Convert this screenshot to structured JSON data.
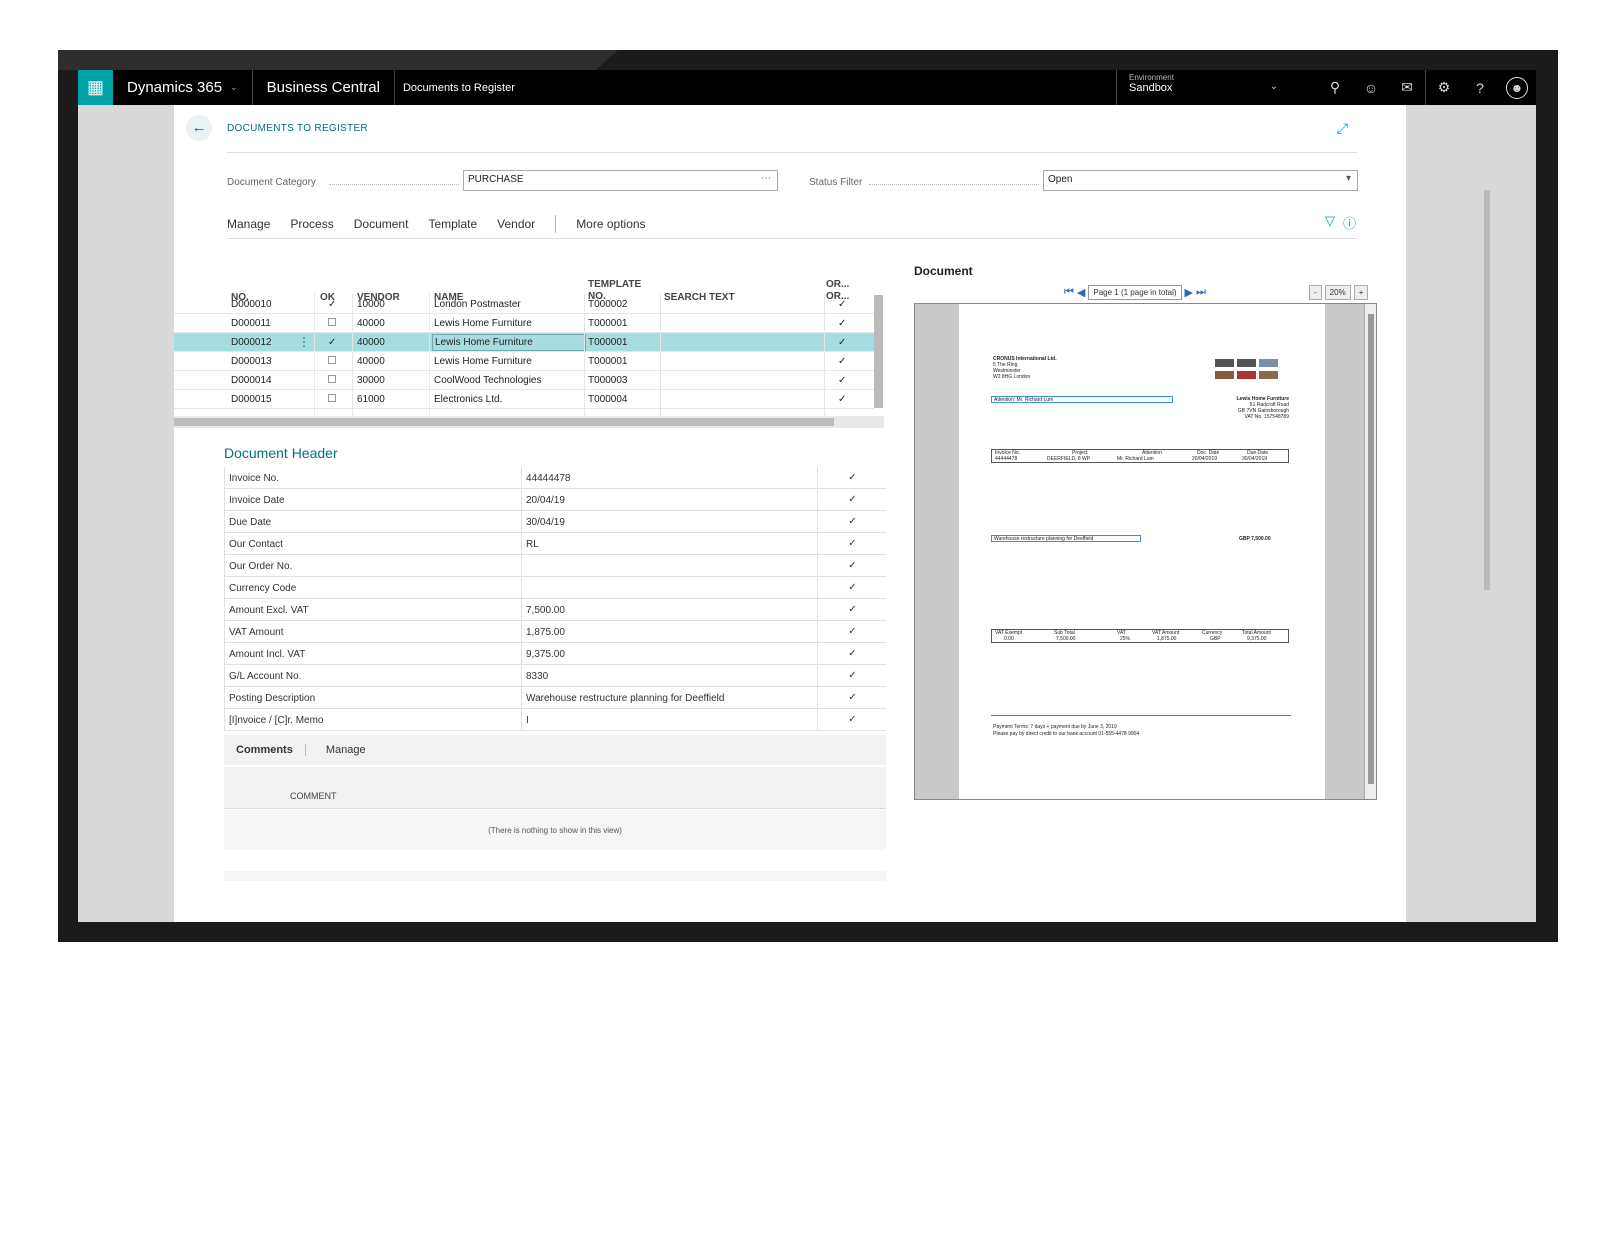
{
  "topbar": {
    "product": "Dynamics 365",
    "app": "Business Central",
    "breadcrumb": "Documents to Register",
    "environment_label": "Environment",
    "environment_value": "Sandbox"
  },
  "page": {
    "title": "DOCUMENTS TO REGISTER",
    "document_category_label": "Document Category",
    "document_category_value": "PURCHASE",
    "status_filter_label": "Status Filter",
    "status_filter_value": "Open"
  },
  "actions": [
    "Manage",
    "Process",
    "Document",
    "Template",
    "Vendor",
    "More options"
  ],
  "grid": {
    "headers": {
      "no": "NO.",
      "ok": "OK",
      "vendor": "VENDOR",
      "name": "NAME",
      "template1": "TEMPLATE",
      "template2": "NO.",
      "search": "SEARCH TEXT",
      "or1": "OR...",
      "or2": "OR..."
    },
    "rows": [
      {
        "no": "D000010",
        "ok": "✓",
        "vendor": "10000",
        "name": "London Postmaster",
        "template": "T000002",
        "or": "✓"
      },
      {
        "no": "D000011",
        "ok": "",
        "vendor": "40000",
        "name": "Lewis Home Furniture",
        "template": "T000001",
        "or": "✓"
      },
      {
        "no": "D000012",
        "ok": "✓",
        "vendor": "40000",
        "name": "Lewis Home Furniture",
        "template": "T000001",
        "or": "✓"
      },
      {
        "no": "D000013",
        "ok": "",
        "vendor": "40000",
        "name": "Lewis Home Furniture",
        "template": "T000001",
        "or": "✓"
      },
      {
        "no": "D000014",
        "ok": "",
        "vendor": "30000",
        "name": "CoolWood Technologies",
        "template": "T000003",
        "or": "✓"
      },
      {
        "no": "D000015",
        "ok": "",
        "vendor": "61000",
        "name": "Electronics Ltd.",
        "template": "T000004",
        "or": "✓"
      }
    ]
  },
  "document_header": {
    "title": "Document Header",
    "rows": [
      {
        "label": "Invoice No.",
        "value": "44444478",
        "check": "✓"
      },
      {
        "label": "Invoice Date",
        "value": "20/04/19",
        "check": "✓"
      },
      {
        "label": "Due Date",
        "value": "30/04/19",
        "check": "✓"
      },
      {
        "label": "Our Contact",
        "value": "RL",
        "check": "✓"
      },
      {
        "label": "Our Order No.",
        "value": "",
        "check": "✓"
      },
      {
        "label": "Currency Code",
        "value": "",
        "check": "✓"
      },
      {
        "label": "Amount Excl. VAT",
        "value": "7,500.00",
        "check": "✓"
      },
      {
        "label": "VAT Amount",
        "value": "1,875.00",
        "check": "✓"
      },
      {
        "label": "Amount Incl. VAT",
        "value": "9,375.00",
        "check": "✓"
      },
      {
        "label": "G/L Account No.",
        "value": "8330",
        "check": "✓"
      },
      {
        "label": "Posting Description",
        "value": "Warehouse restructure planning for Deeffield",
        "check": "✓"
      },
      {
        "label": "[I]nvoice / [C]r. Memo",
        "value": "I",
        "check": "✓"
      }
    ]
  },
  "comments": {
    "tab_comments": "Comments",
    "tab_manage": "Manage",
    "column": "COMMENT",
    "empty": "(There is nothing to show in this view)"
  },
  "document_preview": {
    "title": "Document",
    "page_indicator": "Page 1 (1 page in total)",
    "zoom": "20%",
    "zoom_minus": "-",
    "zoom_plus": "+",
    "sender": [
      "CRONUS International Ltd.",
      "5 The Ring",
      "Westminster",
      "W2 8HG London"
    ],
    "attention": "Attention: Mr. Richard Lum",
    "recipient": [
      "Lewis Home Furniture",
      "51 Radcroft Road",
      "GB 7VN Gainsborough",
      "VAT No. 157548789"
    ],
    "table1_headers": [
      "Invoice No.",
      "Project",
      "Attention",
      "Doc. Date",
      "Due Date"
    ],
    "table1_values": [
      "44444478",
      "DEERFIELD, 8 WP",
      "Mr. Richard Lum",
      "20/04/2019",
      "30/04/2019"
    ],
    "line_description": "Warehouse restructure planning for Deeffield",
    "line_amount": "GBP 7,500.00",
    "table2_headers": [
      "VAT Exempt",
      "Sub Total",
      "VAT",
      "VAT Amount",
      "Currency",
      "Total Amount"
    ],
    "table2_values": [
      "0.00",
      "7,500.00",
      "25%",
      "1,875.00",
      "GBP",
      "9,375.00"
    ],
    "footer1": "Payment Terms: 7 days + payment due by June 3, 2019",
    "footer2": "Please pay by direct credit to our bank account 01-555-4478 9904"
  }
}
